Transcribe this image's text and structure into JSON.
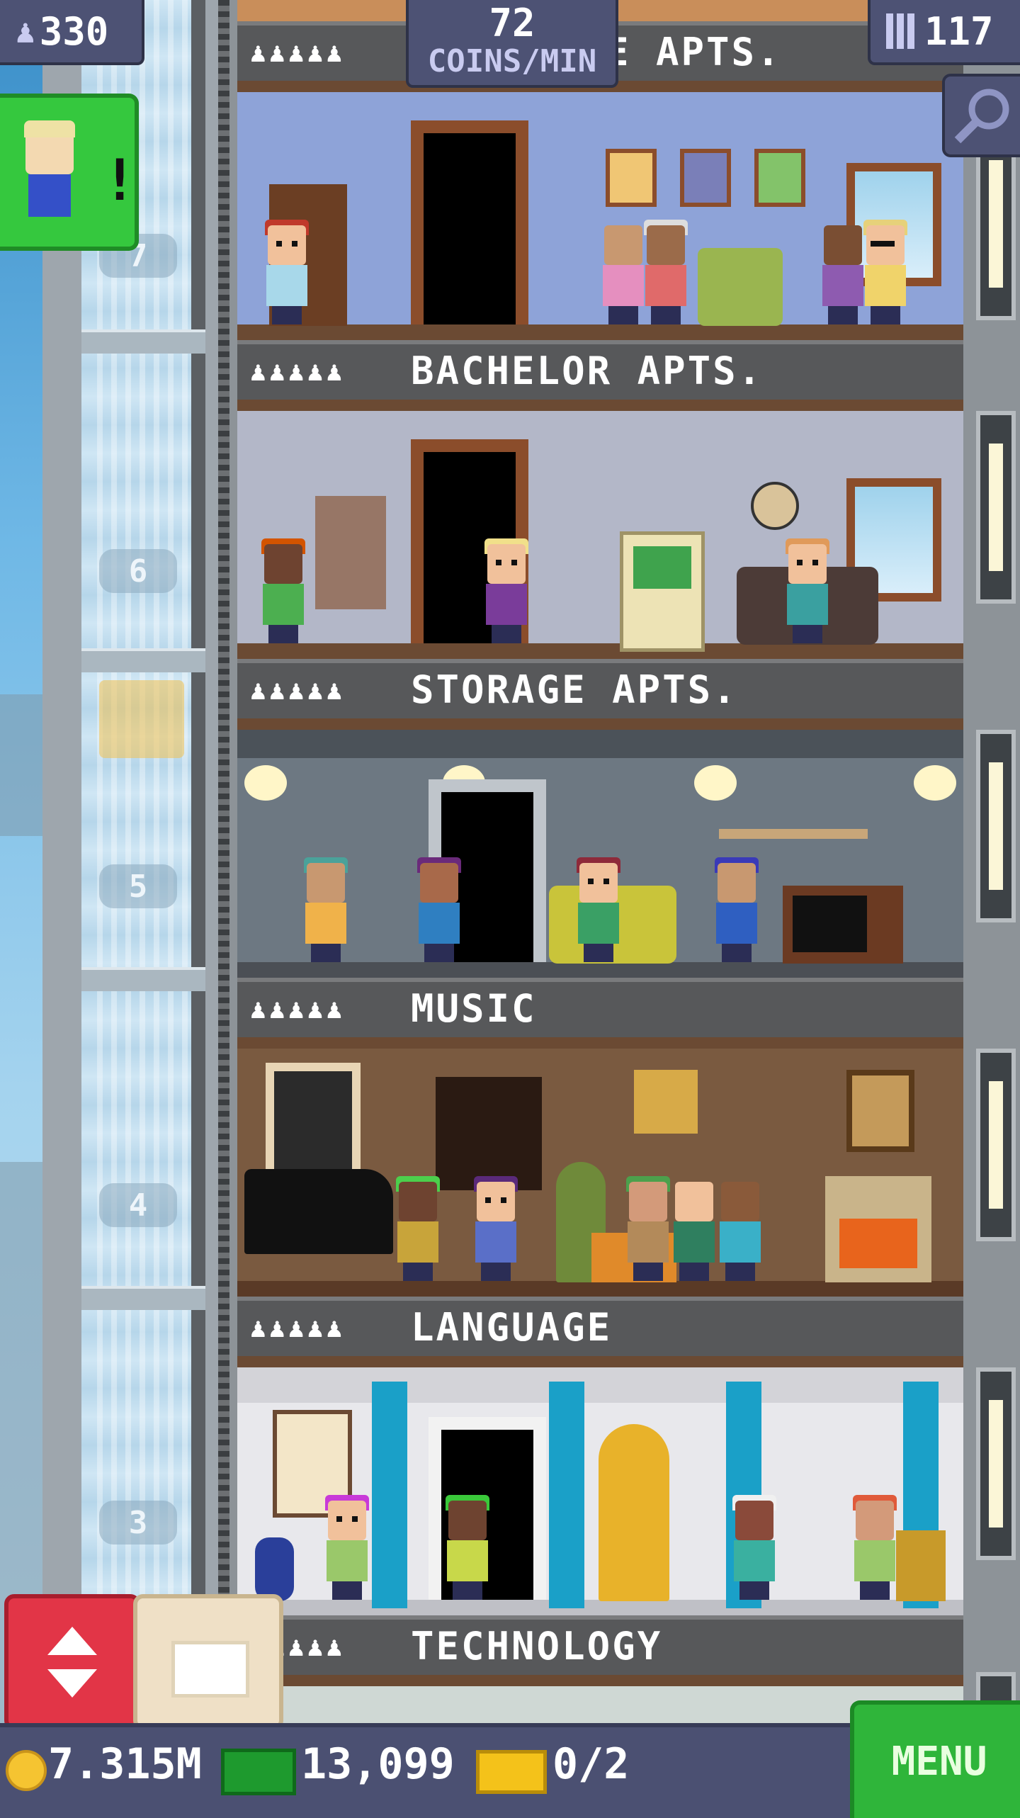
{
  "hud": {
    "population": "330",
    "coins_per_min_value": "72",
    "coins_per_min_unit": "COINS/MIN",
    "floors_count": "117",
    "coins": "7.315M",
    "bux": "13,099",
    "tickets": "0/2",
    "menu_label": "MENU"
  },
  "icons": {
    "population": "person-icon",
    "floors": "building-icon",
    "zoom": "magnifier-icon",
    "coins": "coin-icon",
    "bux": "bux-icon",
    "tickets": "ticket-icon",
    "elevator": "up-down-arrows-icon",
    "build": "crate-icon",
    "visitor_alert": "exclamation-icon"
  },
  "elevator": {
    "floor_numbers": [
      "7",
      "6",
      "5",
      "4",
      "3"
    ]
  },
  "floors": [
    {
      "name": "E APTS.",
      "residents": "♟♟♟♟♟"
    },
    {
      "name": "BACHELOR APTS.",
      "residents": "♟♟♟♟♟"
    },
    {
      "name": "STORAGE APTS.",
      "residents": "♟♟♟♟♟"
    },
    {
      "name": "MUSIC",
      "residents": "♟♟♟♟♟"
    },
    {
      "name": "LANGUAGE",
      "residents": "♟♟♟♟♟"
    },
    {
      "name": "TECHNOLOGY",
      "residents": "♟♟♟♟♟"
    }
  ],
  "colors": {
    "hud_bg": "#4d5274",
    "menu_green": "#2fb53a",
    "elevator_red": "#e23547",
    "floor_wood": "#6b4a33"
  }
}
